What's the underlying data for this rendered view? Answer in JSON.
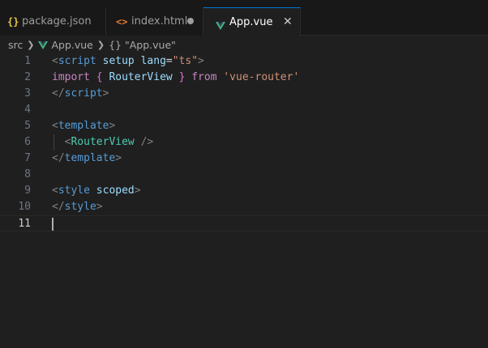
{
  "tabs": [
    {
      "label": "package.json",
      "icon": "{}",
      "icon_color": "#e8c547"
    },
    {
      "label": "index.html",
      "icon": "<>",
      "icon_color": "#e37933"
    },
    {
      "label": "App.vue",
      "icon": "vue-icon",
      "icon_color": "#41b883"
    }
  ],
  "tab_close_glyph": "✕",
  "breadcrumb": {
    "folder": "src",
    "file": "App.vue",
    "symbol_icon": "{}",
    "symbol": "\"App.vue\""
  },
  "lines": [
    {
      "num": "1",
      "tokens": [
        {
          "t": "<",
          "c": "punct"
        },
        {
          "t": "script",
          "c": "tag"
        },
        {
          "t": " ",
          "c": "plain"
        },
        {
          "t": "setup",
          "c": "attr"
        },
        {
          "t": " ",
          "c": "plain"
        },
        {
          "t": "lang",
          "c": "attr"
        },
        {
          "t": "=",
          "c": "eq"
        },
        {
          "t": "\"ts\"",
          "c": "str"
        },
        {
          "t": ">",
          "c": "punct"
        }
      ]
    },
    {
      "num": "2",
      "tokens": [
        {
          "t": "import",
          "c": "kw"
        },
        {
          "t": " ",
          "c": "plain"
        },
        {
          "t": "{",
          "c": "brace"
        },
        {
          "t": " ",
          "c": "plain"
        },
        {
          "t": "RouterView",
          "c": "ident"
        },
        {
          "t": " ",
          "c": "plain"
        },
        {
          "t": "}",
          "c": "brace"
        },
        {
          "t": " ",
          "c": "plain"
        },
        {
          "t": "from",
          "c": "kw"
        },
        {
          "t": " ",
          "c": "plain"
        },
        {
          "t": "'vue-router'",
          "c": "str"
        }
      ]
    },
    {
      "num": "3",
      "tokens": [
        {
          "t": "</",
          "c": "punct"
        },
        {
          "t": "script",
          "c": "tag"
        },
        {
          "t": ">",
          "c": "punct"
        }
      ]
    },
    {
      "num": "4",
      "tokens": []
    },
    {
      "num": "5",
      "tokens": [
        {
          "t": "<",
          "c": "punct"
        },
        {
          "t": "template",
          "c": "tag"
        },
        {
          "t": ">",
          "c": "punct"
        }
      ]
    },
    {
      "num": "6",
      "indent": true,
      "tokens": [
        {
          "t": "  ",
          "c": "plain"
        },
        {
          "t": "<",
          "c": "punct"
        },
        {
          "t": "RouterView",
          "c": "comp"
        },
        {
          "t": " ",
          "c": "plain"
        },
        {
          "t": "/>",
          "c": "punct"
        }
      ]
    },
    {
      "num": "7",
      "tokens": [
        {
          "t": "</",
          "c": "punct"
        },
        {
          "t": "template",
          "c": "tag"
        },
        {
          "t": ">",
          "c": "punct"
        }
      ]
    },
    {
      "num": "8",
      "tokens": []
    },
    {
      "num": "9",
      "tokens": [
        {
          "t": "<",
          "c": "punct"
        },
        {
          "t": "style",
          "c": "tag"
        },
        {
          "t": " ",
          "c": "plain"
        },
        {
          "t": "scoped",
          "c": "attr"
        },
        {
          "t": ">",
          "c": "punct"
        }
      ]
    },
    {
      "num": "10",
      "tokens": [
        {
          "t": "</",
          "c": "punct"
        },
        {
          "t": "style",
          "c": "tag"
        },
        {
          "t": ">",
          "c": "punct"
        }
      ]
    },
    {
      "num": "11",
      "current": true,
      "tokens": []
    }
  ]
}
